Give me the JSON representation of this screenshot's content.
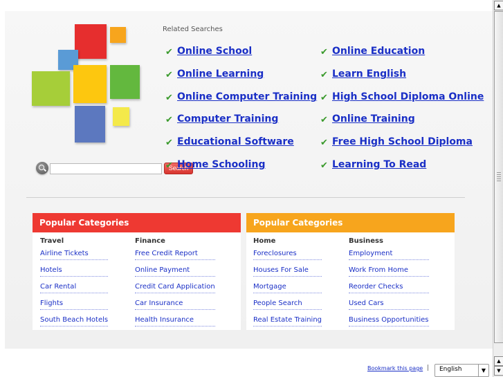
{
  "colors": {
    "link": "#1a2fc6",
    "check": "#3a9a2c",
    "category_red": "#ee3932",
    "category_orange": "#f7a51d",
    "logo": [
      "#e62e2e",
      "#f7a51d",
      "#5a9bd6",
      "#a6ce39",
      "#fdc70f",
      "#63b83e",
      "#5c78bf",
      "#f4e94a"
    ]
  },
  "search": {
    "placeholder": "",
    "button_label": "Search",
    "icon": "magnifier-icon"
  },
  "related": {
    "title": "Related Searches",
    "left": [
      "Online School",
      "Online Learning",
      "Online Computer Training",
      "Computer Training",
      "Educational Software",
      "Home Schooling"
    ],
    "right": [
      "Online Education",
      "Learn English",
      "High School Diploma Online",
      "Online Training",
      "Free High School Diploma",
      "Learning To Read"
    ]
  },
  "categories": [
    {
      "header": "Popular Categories",
      "columns": [
        {
          "title": "Travel",
          "links": [
            "Airline Tickets",
            "Hotels",
            "Car Rental",
            "Flights",
            "South Beach Hotels"
          ]
        },
        {
          "title": "Finance",
          "links": [
            "Free Credit Report",
            "Online Payment",
            "Credit Card Application",
            "Car Insurance",
            "Health Insurance"
          ]
        }
      ]
    },
    {
      "header": "Popular Categories",
      "columns": [
        {
          "title": "Home",
          "links": [
            "Foreclosures",
            "Houses For Sale",
            "Mortgage",
            "People Search",
            "Real Estate Training"
          ]
        },
        {
          "title": "Business",
          "links": [
            "Employment",
            "Work From Home",
            "Reorder Checks",
            "Used Cars",
            "Business Opportunities"
          ]
        }
      ]
    }
  ],
  "footer": {
    "bookmark": "Bookmark this page",
    "separator": "|",
    "language": "English"
  }
}
